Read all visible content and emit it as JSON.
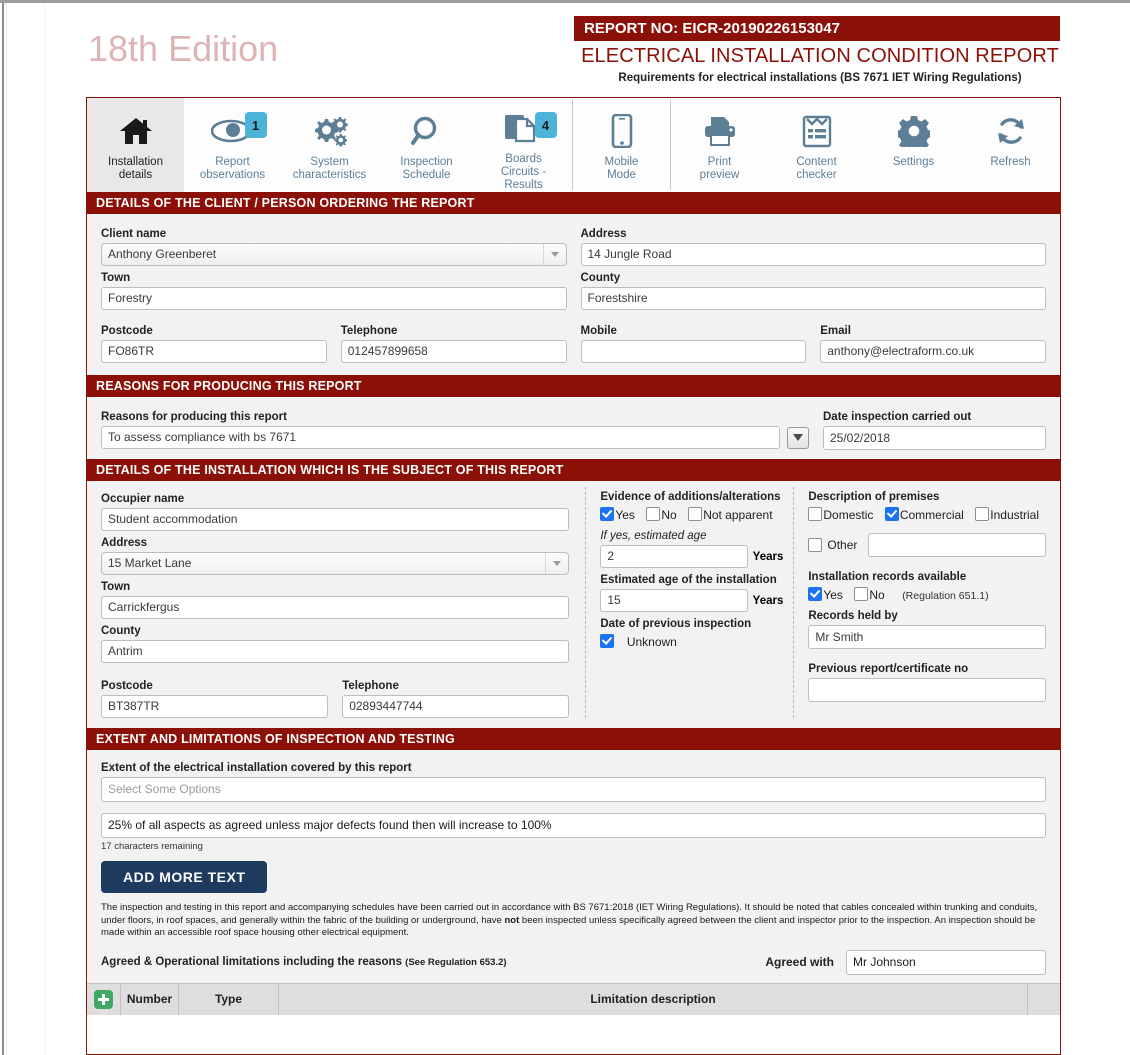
{
  "header": {
    "brand": "18th Edition",
    "report_no": "REPORT NO: EICR-20190226153047",
    "title": "ELECTRICAL INSTALLATION CONDITION REPORT",
    "subtitle": "Requirements for electrical installations (BS 7671 IET Wiring Regulations)"
  },
  "toolbar": {
    "tabs": [
      {
        "label_line1": "Installation",
        "label_line2": "details",
        "icon": "home-icon",
        "badge": "",
        "active": true
      },
      {
        "label_line1": "Report",
        "label_line2": "observations",
        "icon": "eye-icon",
        "badge": "1",
        "active": false
      },
      {
        "label_line1": "System",
        "label_line2": "characteristics",
        "icon": "gears-icon",
        "badge": "",
        "active": false
      },
      {
        "label_line1": "Inspection",
        "label_line2": "Schedule",
        "icon": "magnifier-icon",
        "badge": "",
        "active": false
      },
      {
        "label_line1": "Boards",
        "label_line2": "Circuits -",
        "label_line3": "Results",
        "icon": "documents-icon",
        "badge": "4",
        "active": false
      },
      {
        "label_line1": "Mobile",
        "label_line2": "Mode",
        "icon": "phone-icon",
        "badge": "",
        "active": false
      },
      {
        "label_line1": "Print",
        "label_line2": "preview",
        "icon": "printer-icon",
        "badge": "",
        "active": false
      },
      {
        "label_line1": "Content",
        "label_line2": "checker",
        "icon": "clipboard-icon",
        "badge": "",
        "active": false
      },
      {
        "label_line1": "Settings",
        "label_line2": "",
        "icon": "gear-icon",
        "badge": "",
        "active": false
      },
      {
        "label_line1": "Refresh",
        "label_line2": "",
        "icon": "refresh-icon",
        "badge": "",
        "active": false
      }
    ]
  },
  "client_section": {
    "title": "DETAILS OF THE CLIENT / PERSON ORDERING THE REPORT",
    "client_name_label": "Client name",
    "client_name_value": "Anthony Greenberet",
    "address_label": "Address",
    "address_value": "14 Jungle Road",
    "town_label": "Town",
    "town_value": "Forestry",
    "county_label": "County",
    "county_value": "Forestshire",
    "postcode_label": "Postcode",
    "postcode_value": "FO86TR",
    "telephone_label": "Telephone",
    "telephone_value": "012457899658",
    "mobile_label": "Mobile",
    "mobile_value": "",
    "email_label": "Email",
    "email_value": "anthony@electraform.co.uk"
  },
  "reasons_section": {
    "title": "REASONS FOR PRODUCING THIS REPORT",
    "reasons_label": "Reasons for producing this report",
    "reasons_value": "To assess compliance with bs 7671",
    "date_label": "Date inspection carried out",
    "date_value": "25/02/2018"
  },
  "installation_section": {
    "title": "DETAILS OF THE INSTALLATION WHICH IS THE SUBJECT OF THIS REPORT",
    "occupier_label": "Occupier name",
    "occupier_value": "Student accommodation",
    "address_label": "Address",
    "address_value": "15 Market Lane",
    "town_label": "Town",
    "town_value": "Carrickfergus",
    "county_label": "County",
    "county_value": "Antrim",
    "postcode_label": "Postcode",
    "postcode_value": "BT387TR",
    "telephone_label": "Telephone",
    "telephone_value": "02893447744",
    "evidence_label": "Evidence of additions/alterations",
    "evidence_options": [
      {
        "label": "Yes",
        "checked": true
      },
      {
        "label": "No",
        "checked": false
      },
      {
        "label": "Not apparent",
        "checked": false
      }
    ],
    "if_yes_label": "If yes, estimated age",
    "if_yes_value": "2",
    "years_unit": "Years",
    "est_age_label": "Estimated age of the installation",
    "est_age_value": "15",
    "prev_inspection_label": "Date of previous inspection",
    "unknown_label": "Unknown",
    "unknown_checked": true,
    "premises_label": "Description of premises",
    "premises_options": [
      {
        "label": "Domestic",
        "checked": false
      },
      {
        "label": "Commercial",
        "checked": true
      },
      {
        "label": "Industrial",
        "checked": false
      }
    ],
    "other_label": "Other",
    "other_checked": false,
    "other_value": "",
    "records_label": "Installation records available",
    "records_options": [
      {
        "label": "Yes",
        "checked": true
      },
      {
        "label": "No",
        "checked": false
      }
    ],
    "regulation_note": "(Regulation 651.1)",
    "records_held_label": "Records held by",
    "records_held_value": "Mr Smith",
    "prev_cert_label": "Previous report/certificate no",
    "prev_cert_value": ""
  },
  "extent_section": {
    "title": "EXTENT AND LIMITATIONS OF INSPECTION AND TESTING",
    "extent_label": "Extent of the electrical installation covered by this report",
    "select_placeholder": "Select Some Options",
    "extent_text_value": "25% of all aspects as agreed unless major defects found then will increase to 100%",
    "chars_remaining": "17 characters remaining",
    "add_more_text_button": "ADD MORE TEXT",
    "disclaimer_pre": "The inspection and testing in this report and accompanying schedules have been carried out in accordance with BS 7671:2018 (IET Wiring Regulations). It should be noted that cables concealed within trunking and conduits, under floors, in roof spaces, and generally within the fabric of the building or underground, have ",
    "disclaimer_bold": "not",
    "disclaimer_post": " been inspected unless specifically agreed between the client and inspector prior to the inspection. An inspection should be made within an accessible roof space housing other electrical equipment.",
    "agreed_limitations_label": "Agreed & Operational limitations including the reasons",
    "agreed_limitations_note": "(See Regulation 653.2)",
    "agreed_with_label": "Agreed with",
    "agreed_with_value": "Mr Johnson",
    "table_headers": [
      "Number",
      "Type",
      "Limitation description"
    ]
  },
  "colors": {
    "brand_red": "#8b1007",
    "brand_pink": "#dcb4b4",
    "accent_blue": "#4cb3d9",
    "icon_blue": "#5d7f96",
    "checkbox_blue": "#1a73f0",
    "button_navy": "#1f3a5f",
    "plus_green": "#3fa864"
  }
}
